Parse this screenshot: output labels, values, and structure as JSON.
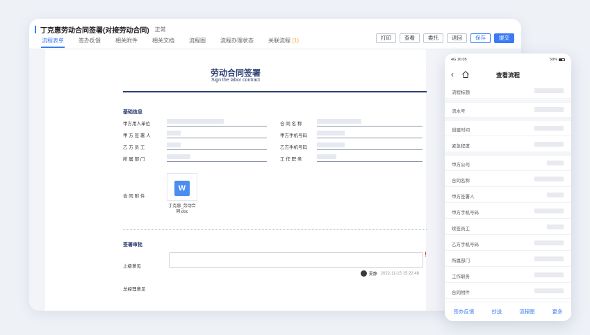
{
  "window": {
    "title": "丁克惠劳动合同签署(对接劳动合同)",
    "status": "正常",
    "tabs": [
      {
        "label": "流程表单",
        "active": true
      },
      {
        "label": "签办反馈",
        "active": false
      },
      {
        "label": "相关附件",
        "active": false
      },
      {
        "label": "相关文档",
        "active": false
      },
      {
        "label": "流程图",
        "active": false
      },
      {
        "label": "流程办理状态",
        "active": false
      },
      {
        "label": "关联流程",
        "active": false,
        "count": "(1)"
      }
    ],
    "toolbar": {
      "print": "打印",
      "view": "查看",
      "delegate": "委托",
      "return": "退回",
      "save": "保存",
      "submit": "提交"
    }
  },
  "doc": {
    "title": "劳动合同签署",
    "subtitle": "Sign the labor contract",
    "basic_section": "基础信息",
    "fields": {
      "employer": "甲方用人单位",
      "contract_name": "合 同 名 称",
      "party_a_signer": "甲 方 签 署 人",
      "party_a_phone": "甲方手机号码",
      "party_b_employee": "乙 方 员 工",
      "party_b_phone": "乙方手机号码",
      "department": "所 属 部 门",
      "position": "工 作 职 务",
      "attachment": "合 同 附 件"
    },
    "attachment_file": "丁克惠_劳动合同.doc",
    "attachment_icon": "W",
    "approval_section": "签署审批",
    "supervisor_opinion": "上级意见",
    "gm_opinion": "总经理意见",
    "required_mark": "!",
    "signer": {
      "name": "夏静",
      "time": "2022-11-15 15:22:48"
    }
  },
  "phone": {
    "time": "16:05",
    "signal": "4G",
    "battery": "59%",
    "title": "查看流程",
    "group1": [
      "流程标题"
    ],
    "group2": [
      "流水号"
    ],
    "group3": [
      "创建时间",
      "紧急程度"
    ],
    "group4": [
      "甲方公司",
      "合同名称",
      "甲方签署人",
      "甲方手机号码",
      "续签员工",
      "乙方手机号码",
      "所属部门",
      "工作职务",
      "合同附件"
    ],
    "footer": {
      "feedback": "签办反馈",
      "cc": "抄送",
      "flowchart": "流程图",
      "more": "更多"
    }
  },
  "colors": {
    "accent": "#3a7bf5",
    "doc_navy": "#2c3e72",
    "required": "#e33333",
    "count": "#f5a623"
  }
}
